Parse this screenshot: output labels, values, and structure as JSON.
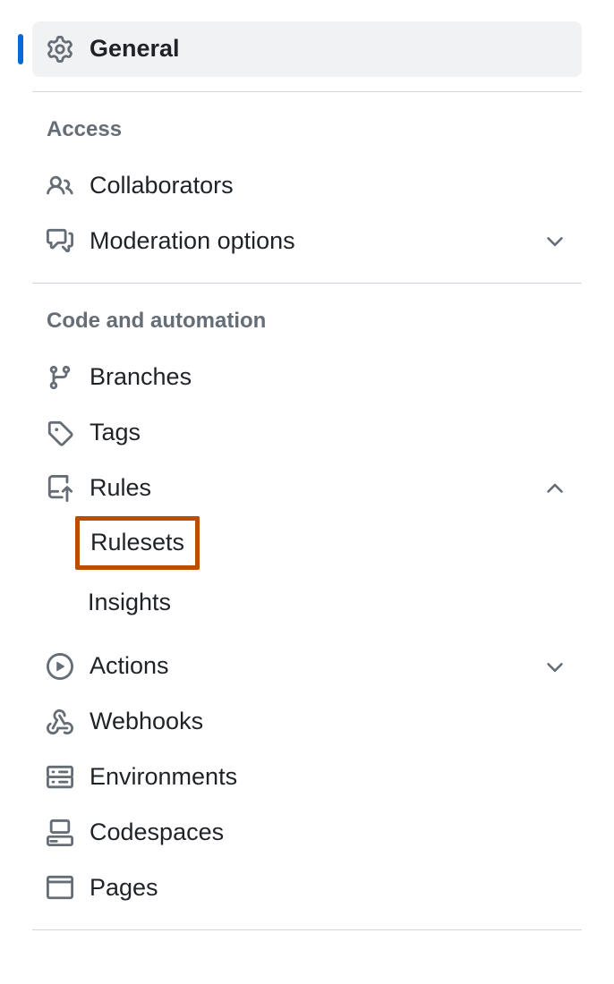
{
  "top": {
    "general": "General"
  },
  "sections": {
    "access": {
      "heading": "Access",
      "collaborators": "Collaborators",
      "moderation": "Moderation options"
    },
    "code": {
      "heading": "Code and automation",
      "branches": "Branches",
      "tags": "Tags",
      "rules": "Rules",
      "rules_sub": {
        "rulesets": "Rulesets",
        "insights": "Insights"
      },
      "actions": "Actions",
      "webhooks": "Webhooks",
      "environments": "Environments",
      "codespaces": "Codespaces",
      "pages": "Pages"
    }
  }
}
